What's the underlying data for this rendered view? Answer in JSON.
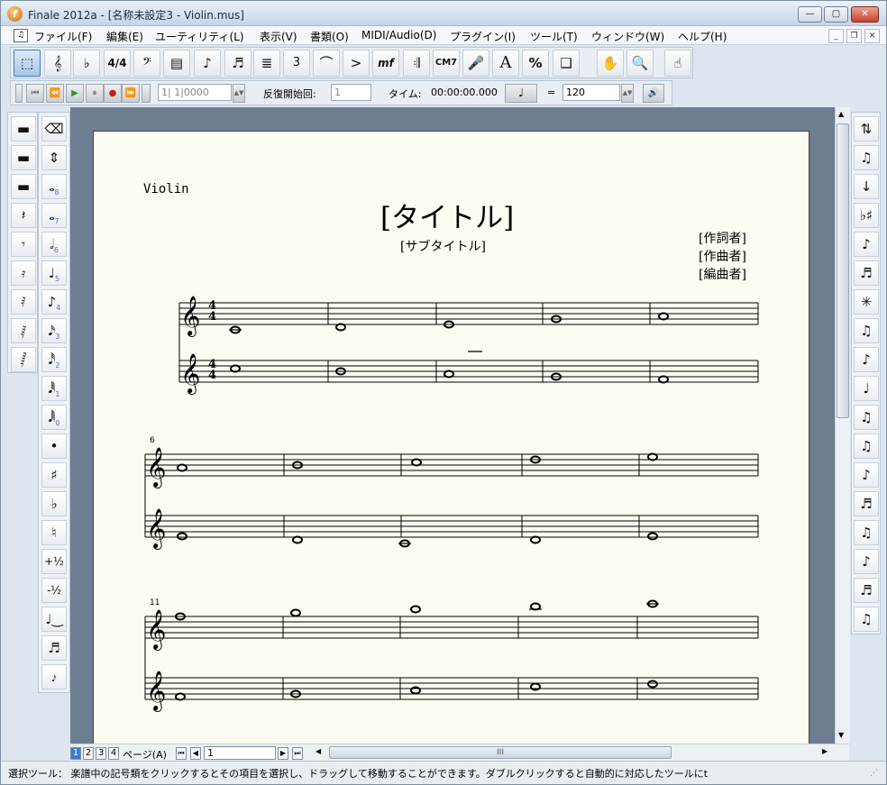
{
  "window": {
    "title": "Finale 2012a - [名称未設定3 - Violin.mus]"
  },
  "menu": [
    "ファイル(F)",
    "編集(E)",
    "ユーティリティ(L)",
    "表示(V)",
    "書類(O)",
    "MIDI/Audio(D)",
    "プラグイン(I)",
    "ツール(T)",
    "ウィンドウ(W)",
    "ヘルプ(H)"
  ],
  "toolbar": {
    "tools": [
      "selection-tool",
      "staff-tool",
      "key-signature-tool",
      "time-signature-tool",
      "clef-tool",
      "measure-tool",
      "simple-entry-tool",
      "speedy-entry-tool",
      "layer-tool",
      "tuplet-tool",
      "smart-shape-tool",
      "articulation-tool",
      "expression-tool",
      "repeat-tool",
      "chord-tool",
      "lyrics-tool",
      "text-tool",
      "resize-tool",
      "special-tools-tool",
      "hand-grabber-tool",
      "zoom-tool",
      "mass-edit-tool"
    ],
    "labels": {
      "tuplet": "3",
      "expression": "mf",
      "chord": "CM7",
      "text": "A",
      "resize": "%"
    }
  },
  "playback": {
    "position": "1| 1|0000",
    "repeat_label": "反復開始回:",
    "repeat_value": "1",
    "time_label": "タイム:",
    "time_value": "00:00:00.000",
    "tempo_eq": "=",
    "tempo_value": "120"
  },
  "score": {
    "instrument": "Violin",
    "title": "[タイトル]",
    "subtitle": "[サブタイトル]",
    "lyricist": "[作詞者]",
    "composer": "[作曲者]",
    "arranger": "[編曲者]",
    "time_sig_num": "4",
    "time_sig_den": "4",
    "measure_num_2": "6",
    "measure_num_3": "11"
  },
  "left_palette_1": [
    "whole-rest",
    "half-rest",
    "whole-rest-2",
    "quarter-rest",
    "eighth-rest",
    "sixteenth-rest",
    "32nd-rest",
    "64th-rest",
    "128th-rest"
  ],
  "left_palette_2": {
    "items": [
      "eraser",
      "half-step",
      "whole-note",
      "half-note",
      "quarter-note",
      "eighth-note",
      "sixteenth-note",
      "32nd-note",
      "64th-note",
      "128th-note",
      "dot",
      "sharp",
      "flat",
      "natural",
      "plus-half",
      "minus-half",
      "tie",
      "grace",
      "grace-slash"
    ],
    "sub": [
      "",
      "",
      "8",
      "7",
      "6",
      "5",
      "4",
      "3",
      "2",
      "1",
      "0"
    ],
    "plus_half": "+½",
    "minus_half": "-½"
  },
  "right_palette": [
    "flip-stem",
    "beam-break",
    "cross-staff",
    "enharmonic",
    "stem-up",
    "beam-extend",
    "flatten-beam",
    "feather",
    "cue",
    "tie-palette",
    "drag",
    "beam-1",
    "beam-2",
    "beam-3",
    "beam-4",
    "beam-5",
    "beam-6",
    "beam-7"
  ],
  "pages": [
    "1",
    "2",
    "3",
    "4"
  ],
  "page_label": "ページ(A)",
  "page_input": "1",
  "scroll_grip": "III",
  "status": "選択ツール： 楽譜中の記号類をクリックするとその項目を選択し、ドラッグして移動することができます。ダブルクリックすると自動的に対応したツールにt"
}
